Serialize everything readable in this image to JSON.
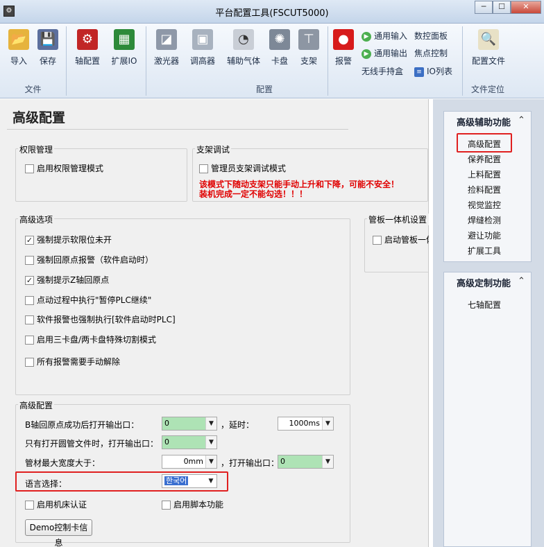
{
  "window": {
    "title": "平台配置工具(FSCUT5000)",
    "min": "─",
    "max": "☐",
    "close": "✕"
  },
  "ribbon": {
    "file_group": {
      "label": "文件",
      "import": "导入",
      "save": "保存"
    },
    "config_group": {
      "label": "配置",
      "axis": "轴配置",
      "extio": "扩展IO",
      "laser": "激光器",
      "height": "调高器",
      "gas": "辅助气体",
      "chuck": "卡盘",
      "support": "支架",
      "alarm": "报警",
      "gen_in": "通用输入",
      "gen_out": "通用输出",
      "wireless": "无线手持盒",
      "nc_panel": "数控面板",
      "focus": "焦点控制",
      "io_list": "IO列表"
    },
    "locate_group": {
      "label": "文件定位",
      "config_file": "配置文件"
    }
  },
  "page": {
    "title": "高级配置"
  },
  "perm": {
    "title": "权限管理",
    "enable": "启用权限管理模式"
  },
  "support": {
    "title": "支架调试",
    "admin": "管理员支架调试模式",
    "warn1": "该模式下随动支架只能手动上升和下降，可能不安全！",
    "warn2": "装机完成一定不能勾选！！！"
  },
  "options": {
    "title": "高级选项",
    "items": [
      {
        "label": "强制提示软限位未开",
        "checked": true
      },
      {
        "label": "强制回原点报警（软件启动时）",
        "checked": false
      },
      {
        "label": "强制提示Z轴回原点",
        "checked": true
      },
      {
        "label": "点动过程中执行\"暂停PLC继续\"",
        "checked": false
      },
      {
        "label": "软件报警也强制执行[软件启动时PLC]",
        "checked": false
      },
      {
        "label": "启用三卡盘/两卡盘特殊切割模式",
        "checked": false
      },
      {
        "label": "所有报警需要手动解除",
        "checked": false
      }
    ]
  },
  "tube": {
    "title": "管板一体机设置",
    "enable": "启动管板一体"
  },
  "adv": {
    "title": "高级配置",
    "b_axis_label": "B轴回原点成功后打开输出口：",
    "b_axis_value": "0",
    "delay_label": "，延时：",
    "delay_value": "1000ms",
    "round_label": "只有打开圆管文件时，打开输出口：",
    "round_value": "0",
    "width_label": "管材最大宽度大于：",
    "width_value": "0mm",
    "width_out_label": "，打开输出口：",
    "width_out_value": "0",
    "lang_label": "语言选择：",
    "lang_value": "한국어",
    "machine_auth": "启用机床认证",
    "script": "启用脚本功能",
    "demo_button": "Demo控制卡信息"
  },
  "side": {
    "aux": {
      "title": "高级辅助功能",
      "collapse": "⌃",
      "items": [
        "高级配置",
        "保养配置",
        "上料配置",
        "捡料配置",
        "视觉监控",
        "焊缝检测",
        "避让功能",
        "扩展工具"
      ]
    },
    "custom": {
      "title": "高级定制功能",
      "collapse": "⌃",
      "items": [
        "七轴配置"
      ]
    }
  }
}
